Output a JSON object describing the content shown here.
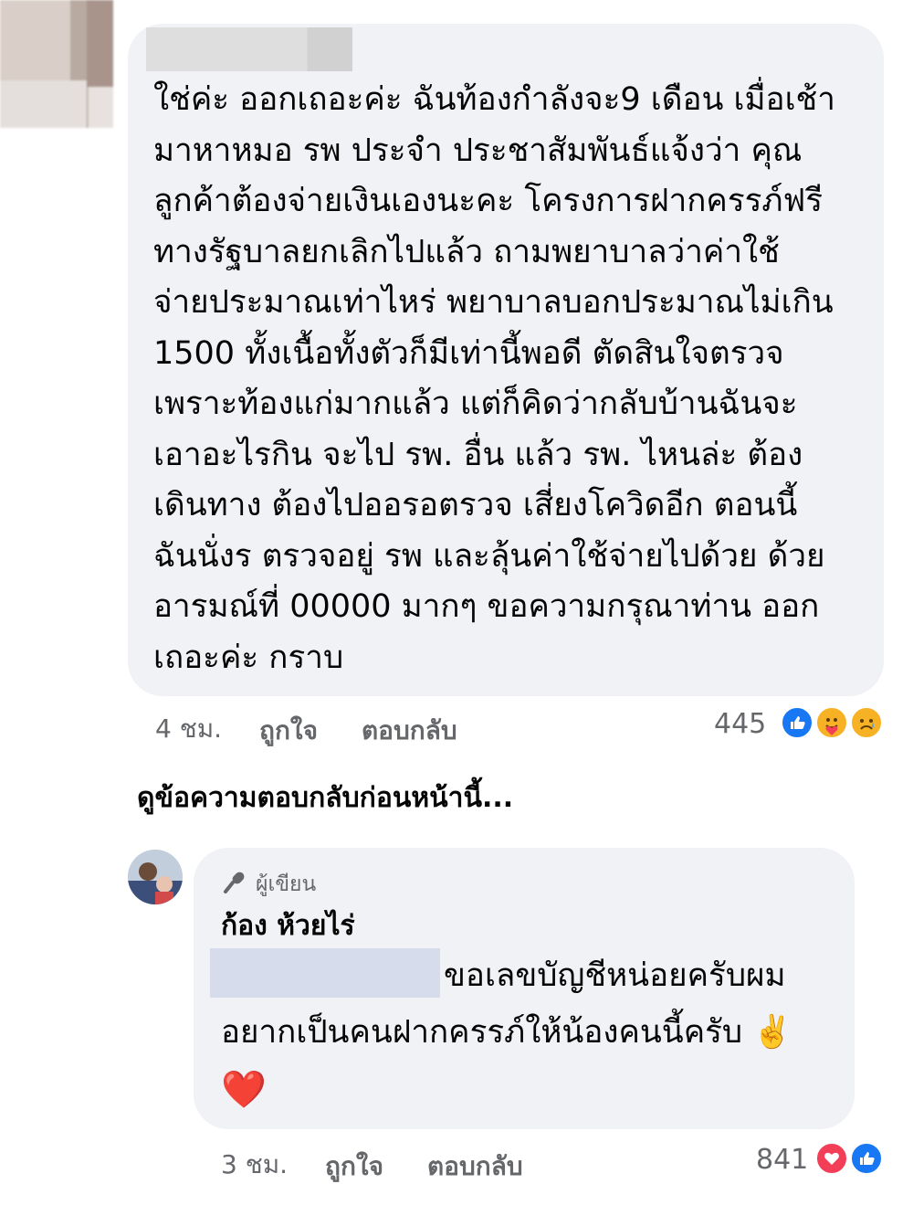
{
  "comment": {
    "lines": [
      "ใช่ค่ะ ออกเถอะค่ะ ฉันท้องกำลังจะ9 เดือน เมื่อเช้า",
      "มาหาหมอ รพ ประจำ ประชาสัมพันธ์แจ้งว่า คุณ",
      "ลูกค้าต้องจ่ายเงินเองนะคะ โครงการฝากครรภ์ฟรี",
      "ทางรัฐบาลยกเลิกไปแล้ว ถามพยาบาลว่าค่าใช้",
      "จ่ายประมาณเท่าไหร่ พยาบาลบอกประมาณไม่เกิน",
      "1500 ทั้งเนื้อทั้งตัวก็มีเท่านี้พอดี ตัดสินใจตรวจ",
      "เพราะท้องแก่มากแล้ว แต่ก็คิดว่ากลับบ้านฉันจะ",
      "เอาอะไรกิน จะไป รพ. อื่น แล้ว รพ. ไหนล่ะ ต้อง",
      "เดินทาง ต้องไปออรอตรวจ เสี่ยงโควิดอีก ตอนนี้",
      "ฉันนั่งร ตรวจอยู่ รพ และลุ้นค่าใช้จ่ายไปด้วย ด้วย",
      "อารมณ์ที่ 00000 มากๆ ขอความกรุณาท่าน ออก",
      "เถอะค่ะ กราบ"
    ],
    "time": "4 ชม.",
    "like_label": "ถูกใจ",
    "reply_label": "ตอบกลับ",
    "reaction_count": "445",
    "reactions": [
      "like-icon",
      "care-icon",
      "sad-icon"
    ]
  },
  "view_previous_replies": "ดูข้อความตอบกลับก่อนหน้านี้...",
  "reply": {
    "author_badge": "ผู้เขียน",
    "author_name": "ก้อง ห้วยไร่",
    "line1": "ขอเลขบัญชีหน่อยครับผม",
    "line2": "อยากเป็นคนฝากครรภ์ให้น้องคนนี้ครับ ✌️",
    "line3": "❤️",
    "time": "3 ชม.",
    "like_label": "ถูกใจ",
    "reply_label": "ตอบกลับ",
    "reaction_count": "841",
    "reactions": [
      "love-icon",
      "like-icon"
    ]
  },
  "colors": {
    "bubble": "#f0f2f5",
    "meta_text": "#65676b",
    "like_blue": "#1877f2",
    "love_red": "#f33e58",
    "reaction_yellow": "#f7b125"
  }
}
